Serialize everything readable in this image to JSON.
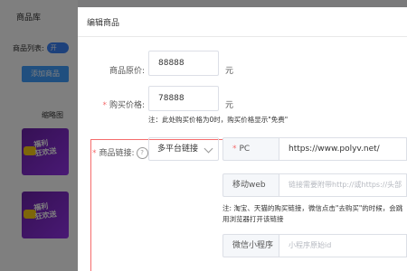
{
  "background": {
    "title": "商品库",
    "list_label": "商品列表:",
    "toggle_label": "开",
    "add_button": "添加商品",
    "thumb_header": "缩略图",
    "thumb_text": "福利\n狂欢送"
  },
  "dialog": {
    "title": "编辑商品",
    "original_price": {
      "label": "商品原价:",
      "value": "88888",
      "unit": "元"
    },
    "purchase_price": {
      "label": "购买价格:",
      "value": "78888",
      "unit": "元"
    },
    "price_note": "注：此处购买价格为0时，购买价格显示\"免费\"",
    "link": {
      "label": "商品链接:",
      "help_icon": "?",
      "platform_select": "多平台链接",
      "pc_label": "PC",
      "pc_value": "https://www.polyv.net/",
      "mobile_label": "移动web",
      "mobile_placeholder": "链接需要附带http://或https://头部",
      "note_line1": "注: 淘宝、天猫的购买链接，微信点击\"去购买\"的时候，会跳",
      "note_line2": "用浏览器打开该链接",
      "miniprogram_label": "微信小程序",
      "miniprogram_placeholder": "小程序原始id"
    }
  },
  "colors": {
    "required": "#f56c6c",
    "primary": "#409eff",
    "highlight_border": "#f56c6c"
  }
}
